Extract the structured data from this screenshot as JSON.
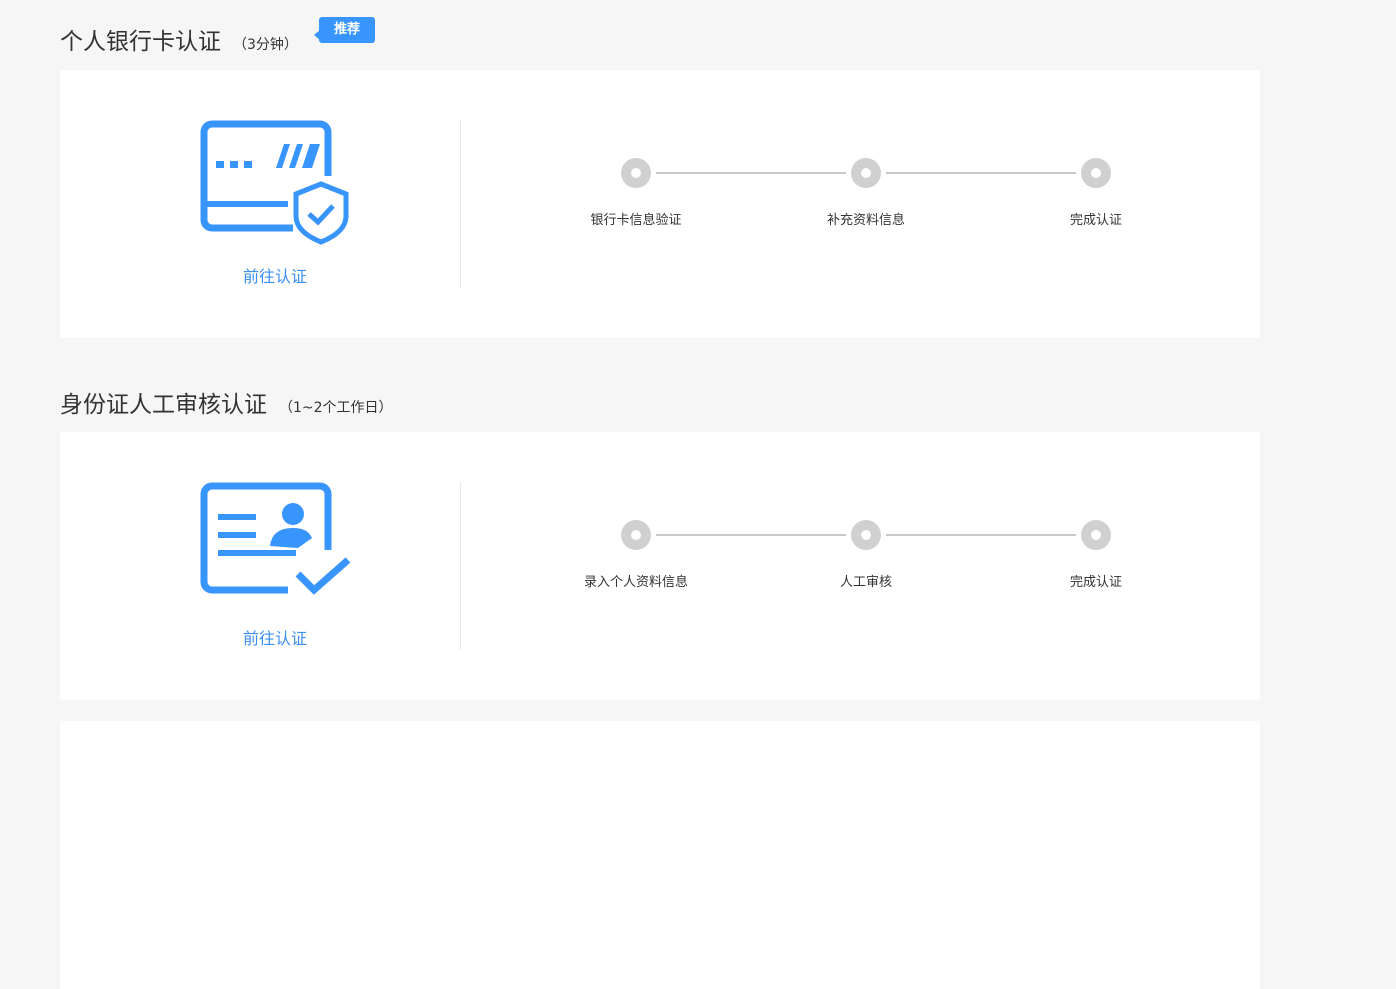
{
  "sections": [
    {
      "title": "个人银行卡认证",
      "subtitle": "（3分钟）",
      "badge": "推荐",
      "action": "前往认证",
      "steps": [
        "银行卡信息验证",
        "补充资料信息",
        "完成认证"
      ]
    },
    {
      "title": "身份证人工审核认证",
      "subtitle": "（1~2个工作日）",
      "action": "前往认证",
      "steps": [
        "录入个人资料信息",
        "人工审核",
        "完成认证"
      ]
    }
  ],
  "colors": {
    "accent": "#3895fd",
    "step_inactive": "#d0d0d0"
  }
}
